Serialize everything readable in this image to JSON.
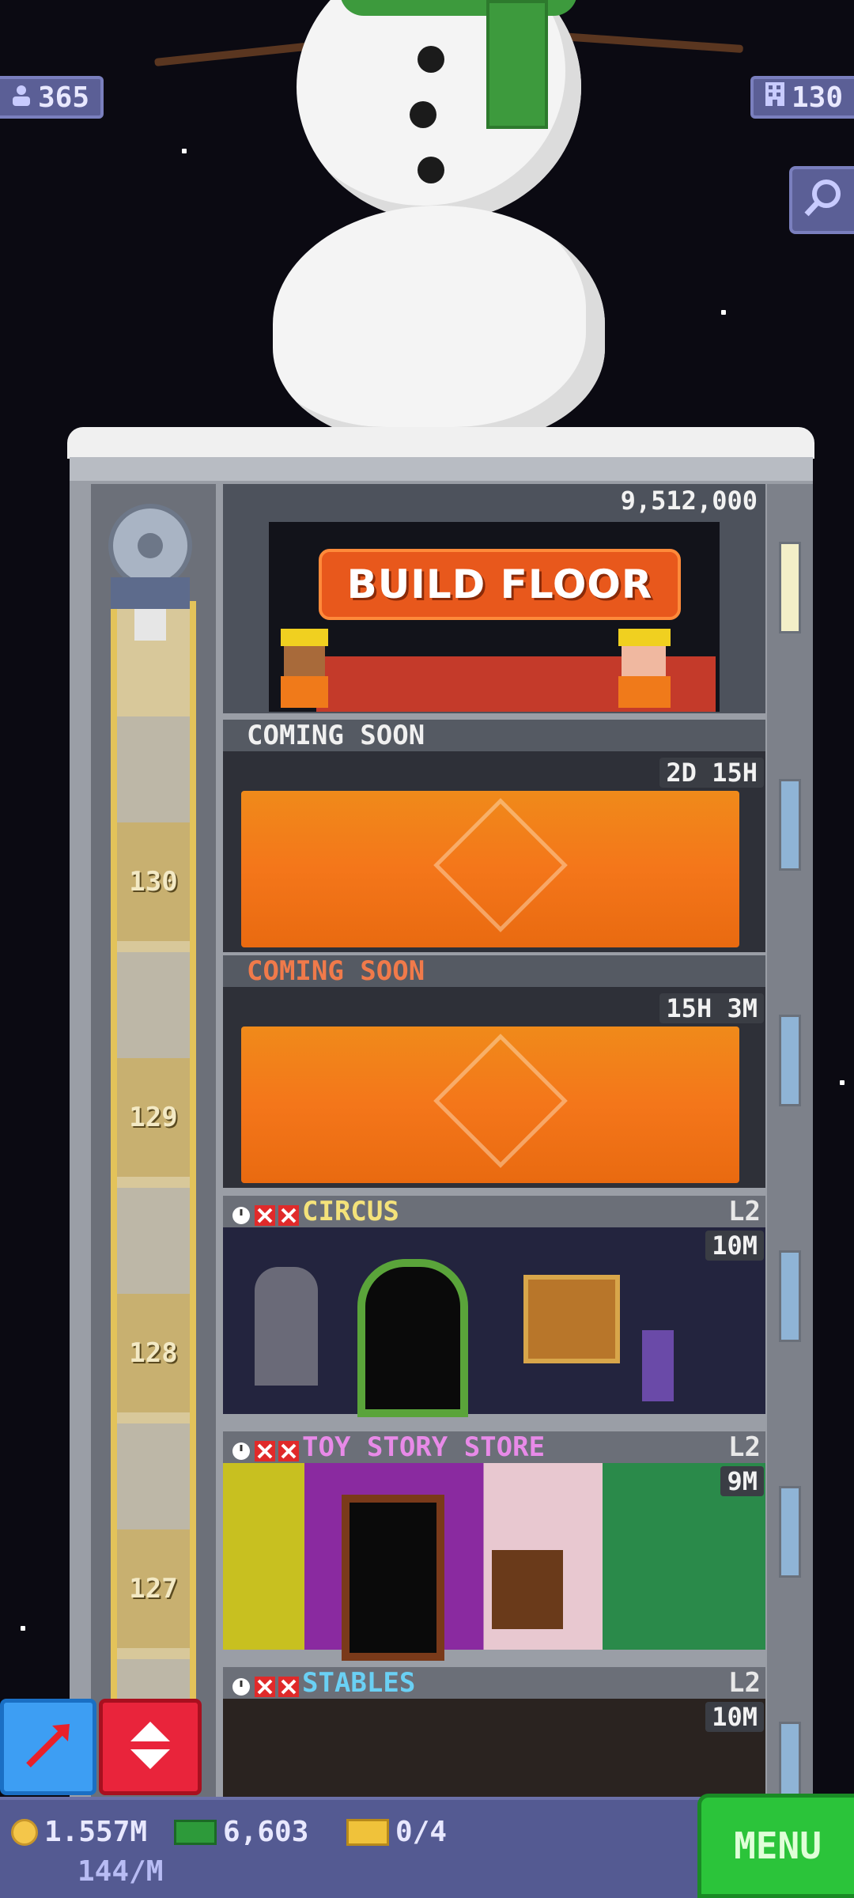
{
  "top_left_badge": {
    "icon": "people-icon",
    "value": "365"
  },
  "top_right_badge": {
    "icon": "building-icon",
    "value": "130"
  },
  "build": {
    "cost": "9,512,000",
    "button_label": "BUILD FLOOR"
  },
  "floors": [
    {
      "floor_number": "130",
      "name": "COMING SOON",
      "timer": "2D 15H",
      "name_color": "#eeeeee"
    },
    {
      "floor_number": "129",
      "name": "COMING SOON",
      "timer": "15H 3M",
      "name_color": "#f07a4a"
    },
    {
      "floor_number": "128",
      "name": "CIRCUS",
      "timer": "10M",
      "level": "L2",
      "name_color": "#f4e27a"
    },
    {
      "floor_number": "127",
      "name": "TOY STORY STORE",
      "timer": "9M",
      "level": "L2",
      "name_color": "#e88ae8"
    },
    {
      "floor_number": "",
      "name": "STABLES",
      "timer": "10M",
      "level": "L2",
      "name_color": "#6ad0f4"
    }
  ],
  "bottom": {
    "coins": "1.557M",
    "rate": "144/M",
    "bux": "6,603",
    "tickets": "0/4",
    "menu_label": "MENU"
  },
  "colors": {
    "accent": "#e8581c",
    "menu": "#2bc43a",
    "bar": "#545a92"
  }
}
